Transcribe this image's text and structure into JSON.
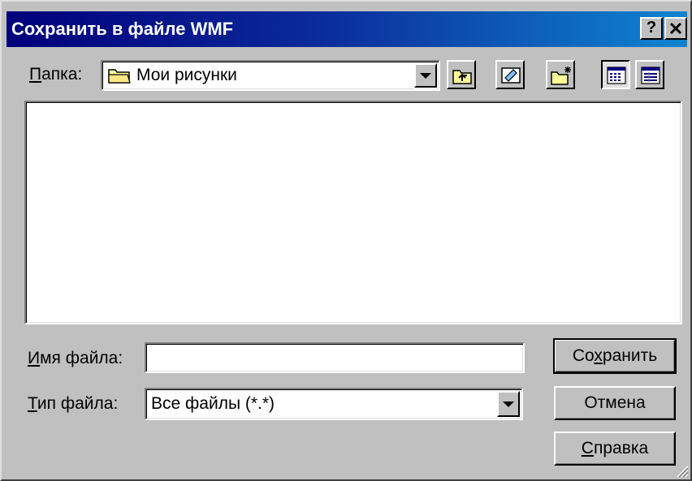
{
  "dialog": {
    "title": "Сохранить в файле WMF",
    "help_button": "?",
    "close_button": "×"
  },
  "folder": {
    "label_accel": "П",
    "label_rest": "апка:",
    "current": "Мои рисунки"
  },
  "toolbar": {
    "buttons": [
      "up-one-level",
      "desktop",
      "create-new-folder",
      "list-view",
      "details-view"
    ],
    "active_view": "list-view"
  },
  "file_list": {
    "items": []
  },
  "filename": {
    "label_accel": "И",
    "label_rest": "мя файла:",
    "value": ""
  },
  "filetype": {
    "label_accel": "Т",
    "label_rest": "ип файла:",
    "value": "Все файлы (*.*)"
  },
  "buttons": {
    "save_pre": "Со",
    "save_accel": "х",
    "save_post": "ранить",
    "cancel": "Отмена",
    "help_accel": "С",
    "help_rest": "правка"
  },
  "colors": {
    "face": "#c0c0c0",
    "title_start": "#00007b",
    "title_end": "#1084d0",
    "folder_yellow": "#ffff99"
  }
}
